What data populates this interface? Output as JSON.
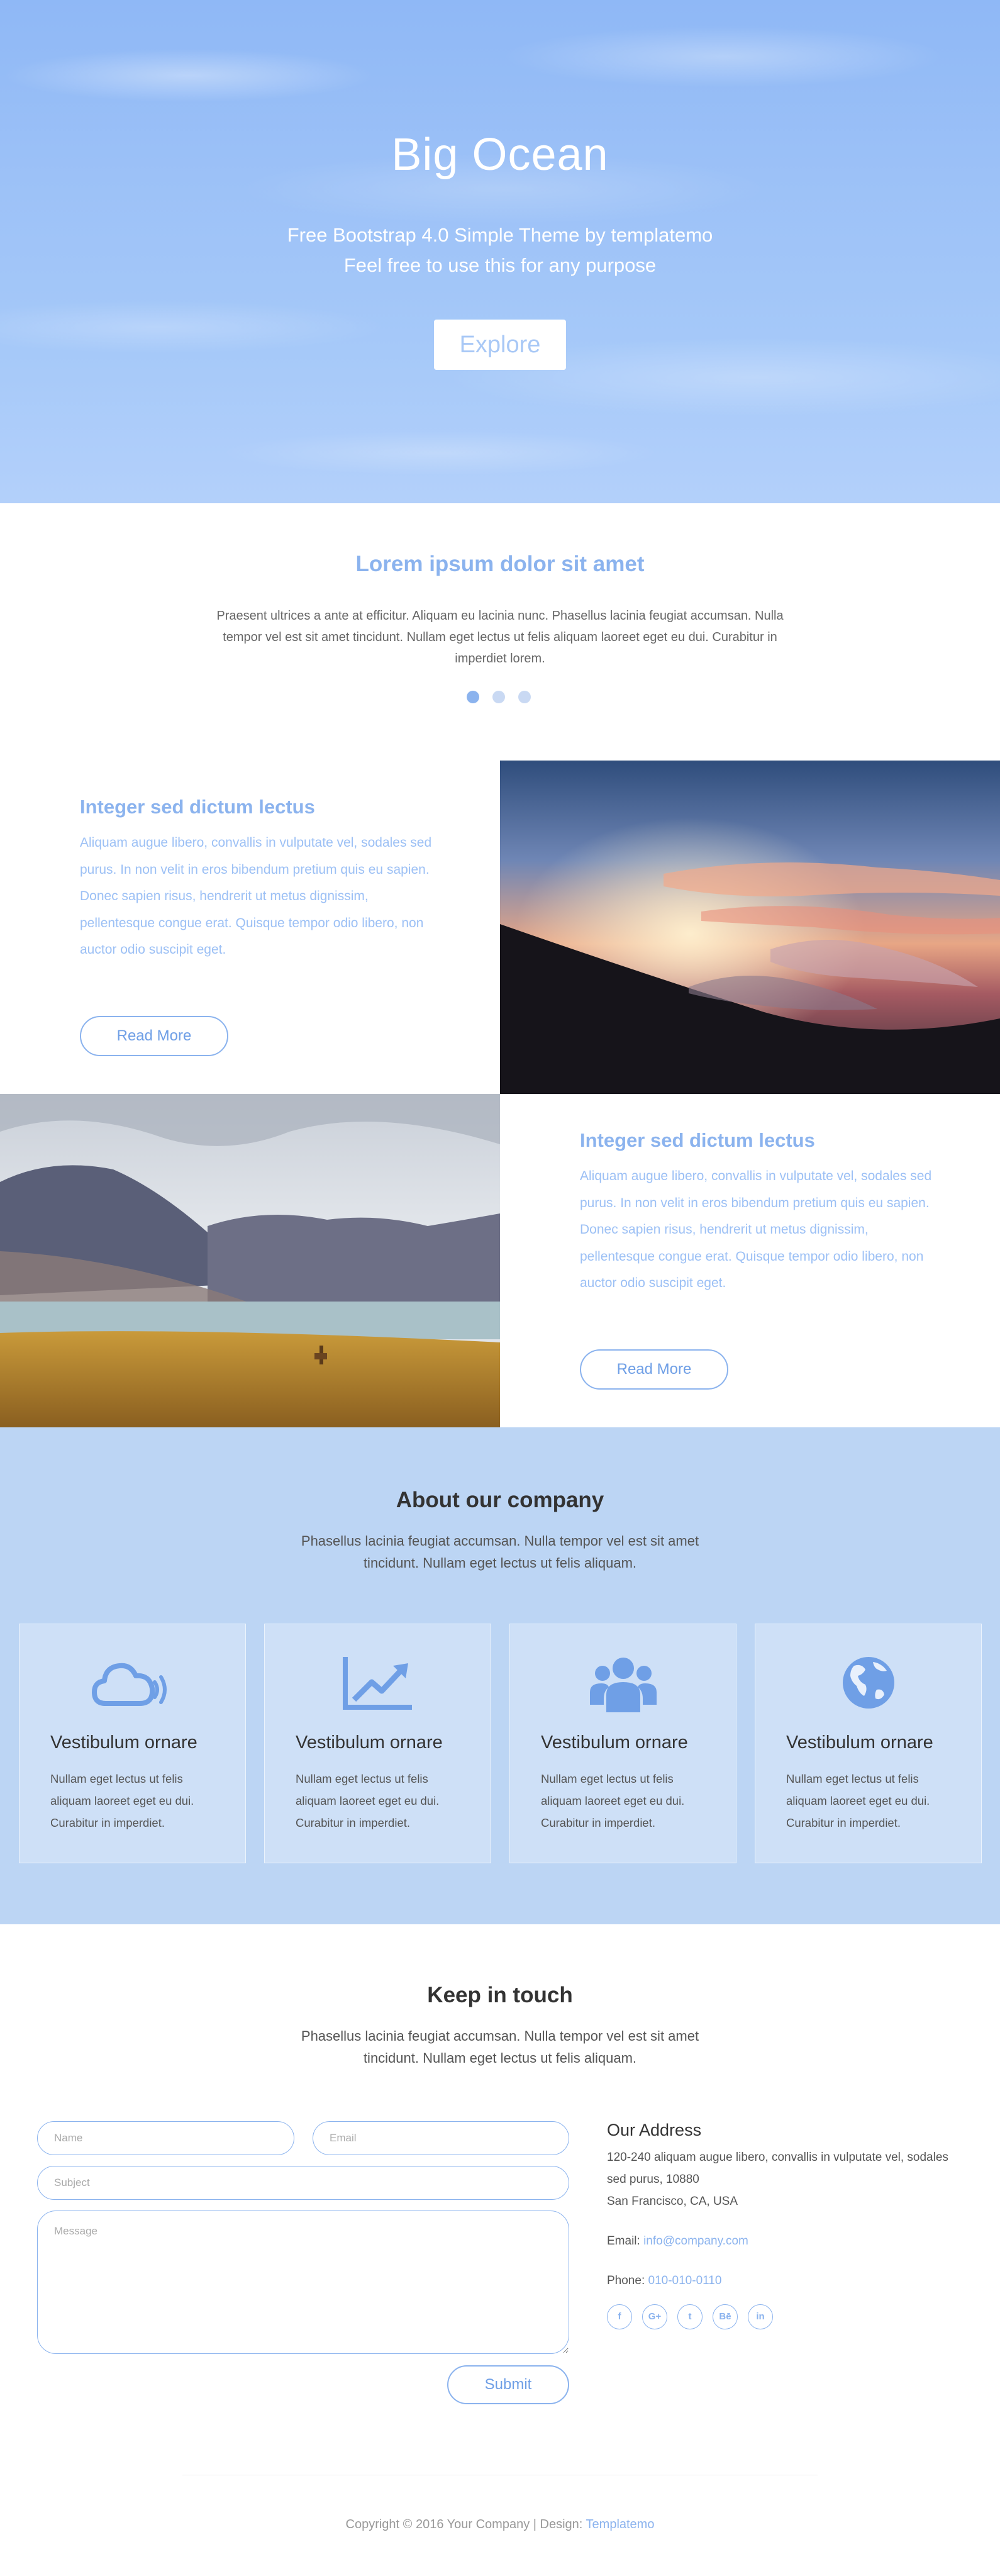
{
  "hero": {
    "title": "Big Ocean",
    "subtitle_line1": "Free Bootstrap 4.0 Simple Theme by templatemo",
    "subtitle_line2": "Feel free to use this for any purpose",
    "button_label": "Explore"
  },
  "intro": {
    "title": "Lorem ipsum dolor sit amet",
    "text": "Praesent ultrices a ante at efficitur. Aliquam eu lacinia nunc. Phasellus lacinia feugiat accumsan. Nulla tempor vel est sit amet tincidunt. Nullam eget lectus ut felis aliquam laoreet eget eu dui. Curabitur in imperdiet lorem.",
    "slider_dots": 3,
    "active_dot": 0
  },
  "features": [
    {
      "title": "Integer sed dictum lectus",
      "text": "Aliquam augue libero, convallis in vulputate vel, sodales sed purus. In non velit in eros bibendum pretium quis eu sapien. Donec sapien risus, hendrerit ut metus dignissim, pellentesque congue erat. Quisque tempor odio libero, non auctor odio suscipit eget.",
      "button_label": "Read More",
      "image": "sunset-clouds-mountain-photo"
    },
    {
      "title": "Integer sed dictum lectus",
      "text": "Aliquam augue libero, convallis in vulputate vel, sodales sed purus. In non velit in eros bibendum pretium quis eu sapien. Donec sapien risus, hendrerit ut metus dignissim, pellentesque congue erat. Quisque tempor odio libero, non auctor odio suscipit eget.",
      "button_label": "Read More",
      "image": "mountain-lake-vicuna-photo"
    }
  ],
  "about": {
    "title": "About our company",
    "text": "Phasellus lacinia feugiat accumsan. Nulla tempor vel est sit amet tincidunt. Nullam eget lectus ut felis aliquam.",
    "cards": [
      {
        "icon": "cloud-signal-icon",
        "title": "Vestibulum ornare",
        "text": "Nullam eget lectus ut felis aliquam laoreet eget eu dui. Curabitur in imperdiet."
      },
      {
        "icon": "line-chart-icon",
        "title": "Vestibulum ornare",
        "text": "Nullam eget lectus ut felis aliquam laoreet eget eu dui. Curabitur in imperdiet."
      },
      {
        "icon": "users-group-icon",
        "title": "Vestibulum ornare",
        "text": "Nullam eget lectus ut felis aliquam laoreet eget eu dui. Curabitur in imperdiet."
      },
      {
        "icon": "globe-icon",
        "title": "Vestibulum ornare",
        "text": "Nullam eget lectus ut felis aliquam laoreet eget eu dui. Curabitur in imperdiet."
      }
    ]
  },
  "contact": {
    "title": "Keep in touch",
    "text": "Phasellus lacinia feugiat accumsan. Nulla tempor vel est sit amet tincidunt. Nullam eget lectus ut felis aliquam.",
    "form": {
      "name_placeholder": "Name",
      "email_placeholder": "Email",
      "subject_placeholder": "Subject",
      "message_placeholder": "Message",
      "submit_label": "Submit"
    },
    "address": {
      "title": "Our Address",
      "line1": "120-240 aliquam augue libero, convallis in vulputate vel, sodales sed purus, 10880",
      "line2": "San Francisco, CA, USA",
      "email_label": "Email:",
      "email": "info@company.com",
      "phone_label": "Phone:",
      "phone": "010-010-0110"
    },
    "socials": [
      {
        "icon": "facebook-icon",
        "glyph": "f"
      },
      {
        "icon": "google-plus-icon",
        "glyph": "G+"
      },
      {
        "icon": "twitter-icon",
        "glyph": "t"
      },
      {
        "icon": "behance-icon",
        "glyph": "Bē"
      },
      {
        "icon": "linkedin-icon",
        "glyph": "in"
      }
    ]
  },
  "footer": {
    "copyright": "Copyright © 2016 Your Company | Design: ",
    "design_link": "Templatemo"
  },
  "colors": {
    "accent": "#8bb3ee",
    "hero_background": "#9cc1f7",
    "about_background": "#bcd5f4",
    "heading_text": "#333333"
  }
}
